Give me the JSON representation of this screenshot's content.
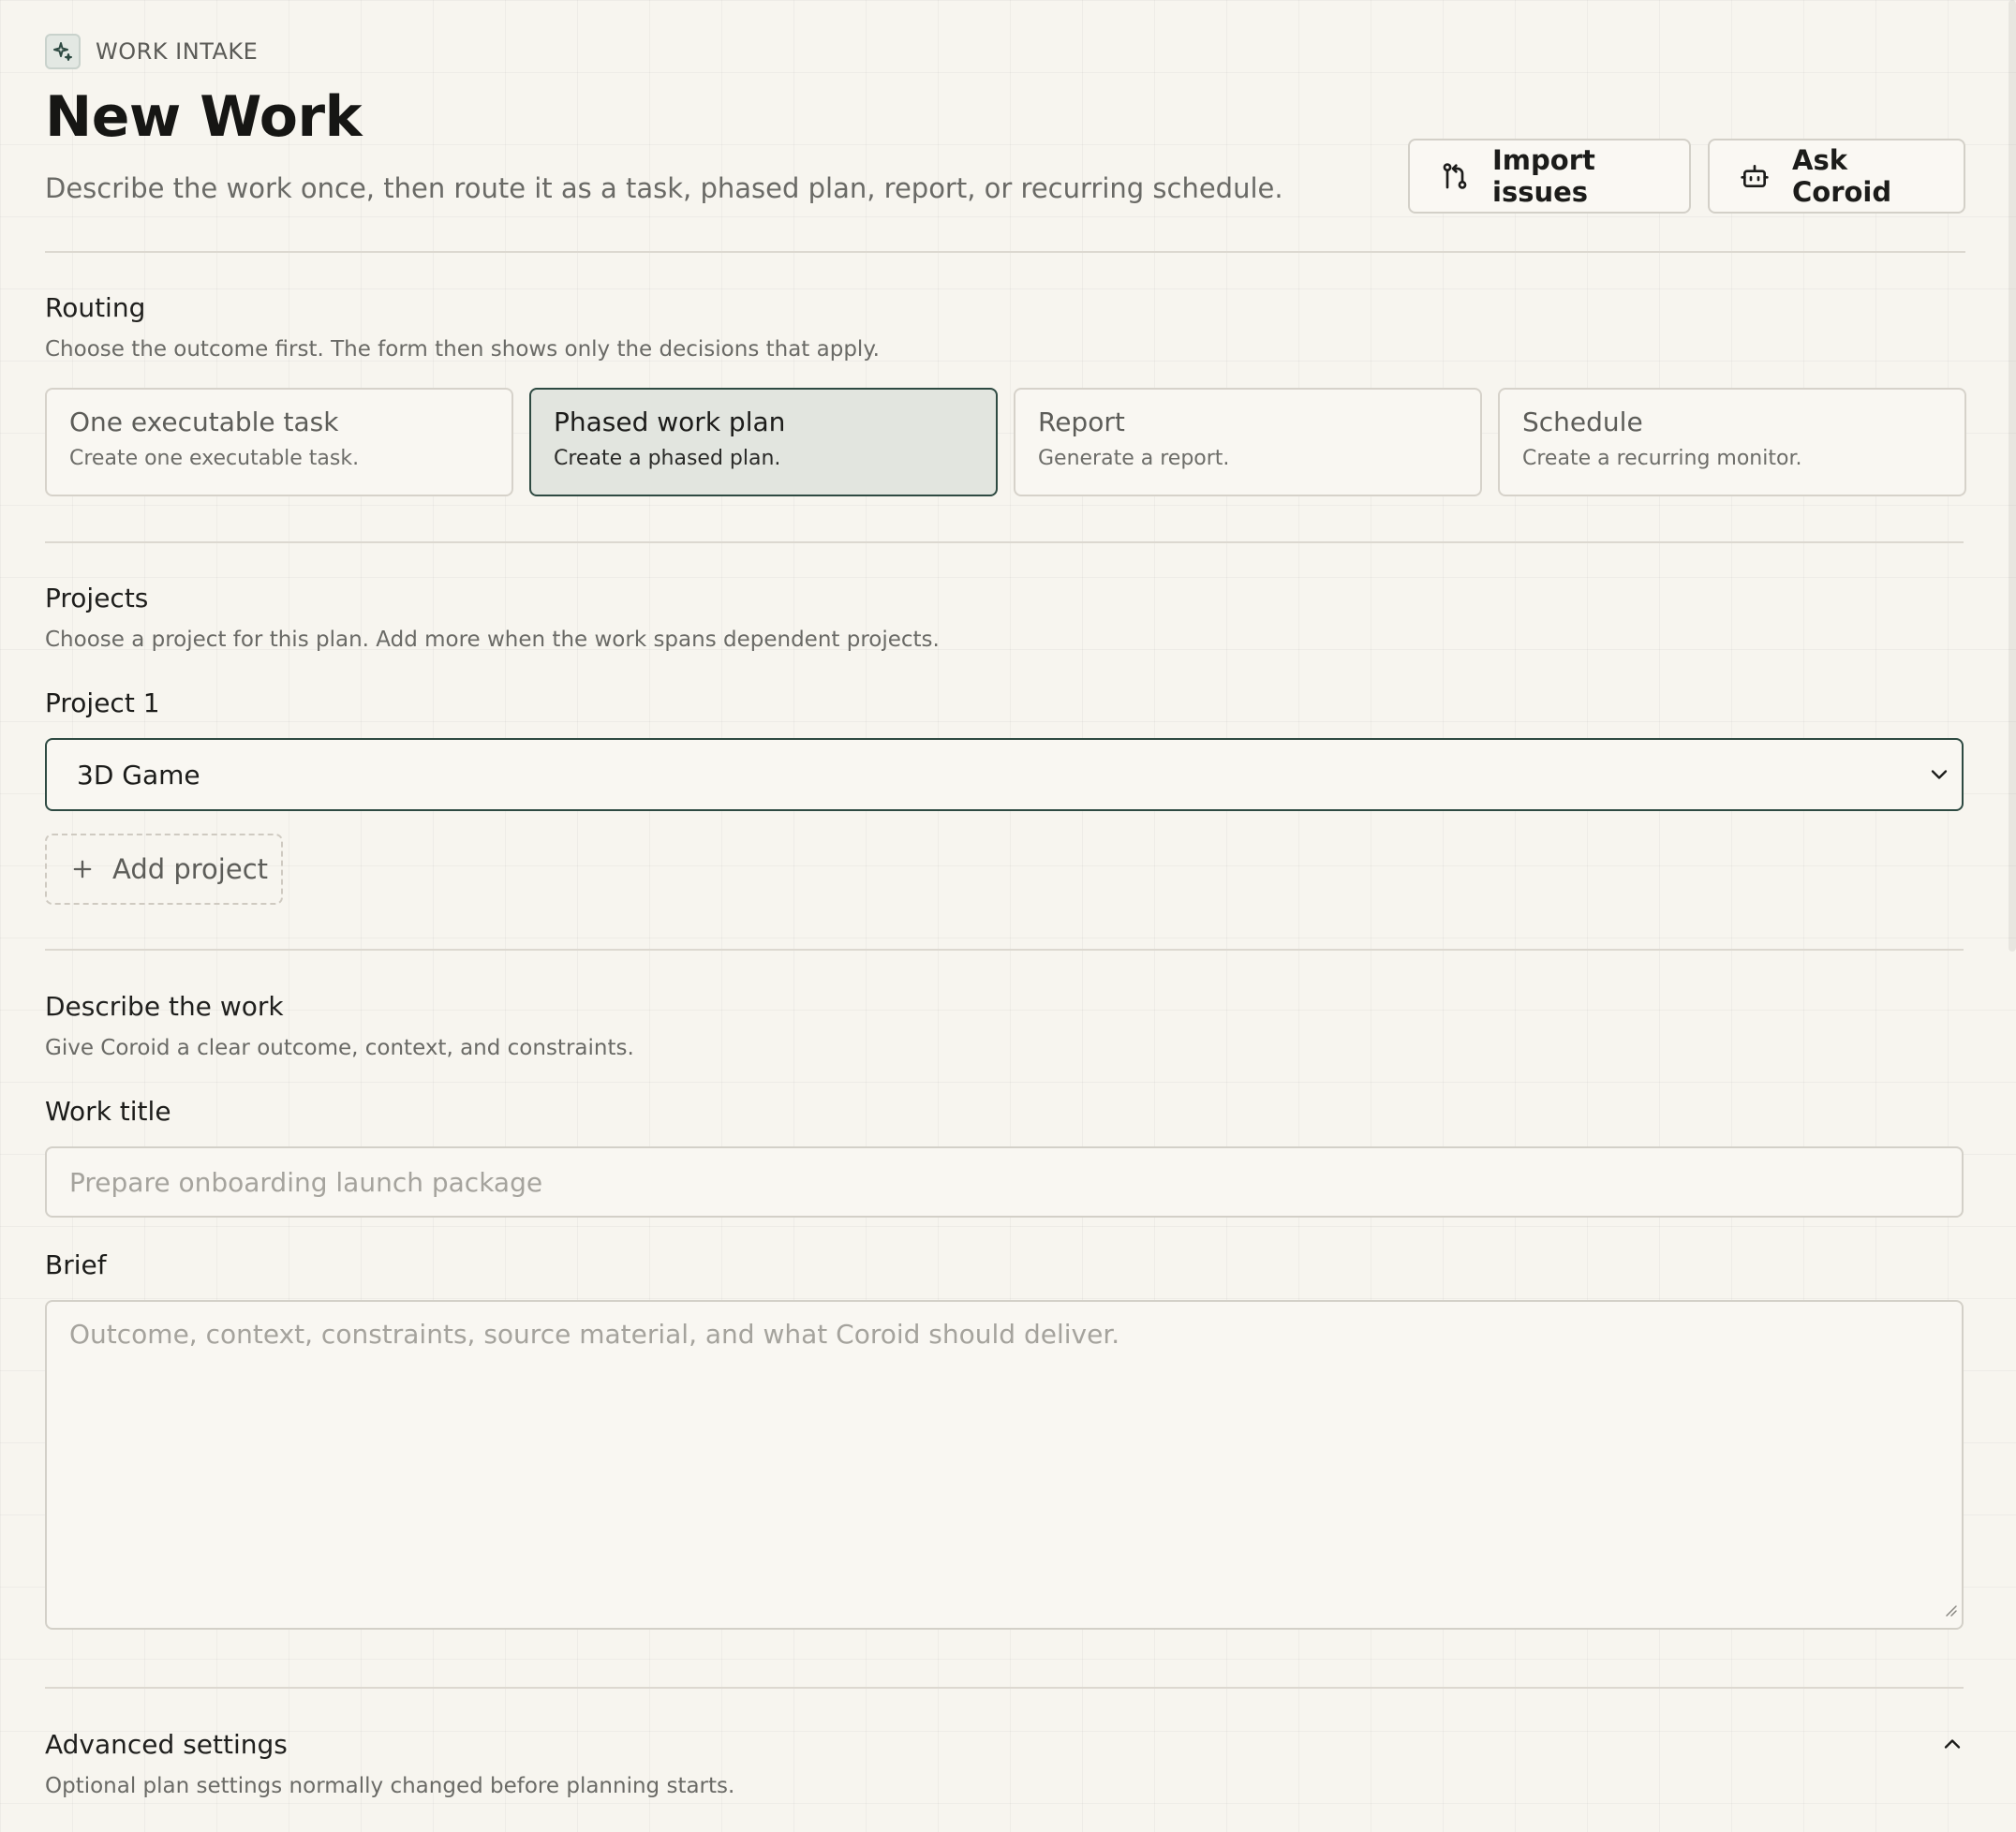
{
  "header": {
    "eyebrow": "WORK INTAKE",
    "title": "New Work",
    "subtitle": "Describe the work once, then route it as a task, phased plan, report, or recurring schedule.",
    "actions": {
      "import_label": "Import issues",
      "ask_label": "Ask Coroid"
    }
  },
  "routing": {
    "title": "Routing",
    "description": "Choose the outcome first. The form then shows only the decisions that apply.",
    "options": [
      {
        "title": "One executable task",
        "description": "Create one executable task.",
        "selected": false
      },
      {
        "title": "Phased work plan",
        "description": "Create a phased plan.",
        "selected": true
      },
      {
        "title": "Report",
        "description": "Generate a report.",
        "selected": false
      },
      {
        "title": "Schedule",
        "description": "Create a recurring monitor.",
        "selected": false
      }
    ]
  },
  "projects": {
    "title": "Projects",
    "description": "Choose a project for this plan. Add more when the work spans dependent projects.",
    "project_label": "Project 1",
    "selected_project": "3D Game",
    "add_label": "Add project"
  },
  "describe": {
    "title": "Describe the work",
    "description": "Give Coroid a clear outcome, context, and constraints.",
    "work_title_label": "Work title",
    "work_title_placeholder": "Prepare onboarding launch package",
    "brief_label": "Brief",
    "brief_placeholder": "Outcome, context, constraints, source material, and what Coroid should deliver."
  },
  "advanced": {
    "title": "Advanced settings",
    "description": "Optional plan settings normally changed before planning starts."
  },
  "colors": {
    "background": "#f7f5ef",
    "accent": "#2e4a42",
    "selected_card": "#e2e5df",
    "border": "#d3d0c8"
  },
  "icons": {
    "eyebrow": "sparkle-icon",
    "import": "git-pull-request-icon",
    "ask": "robot-icon",
    "select": "chevron-down-icon",
    "add": "plus-icon",
    "advanced": "chevron-up-icon"
  }
}
